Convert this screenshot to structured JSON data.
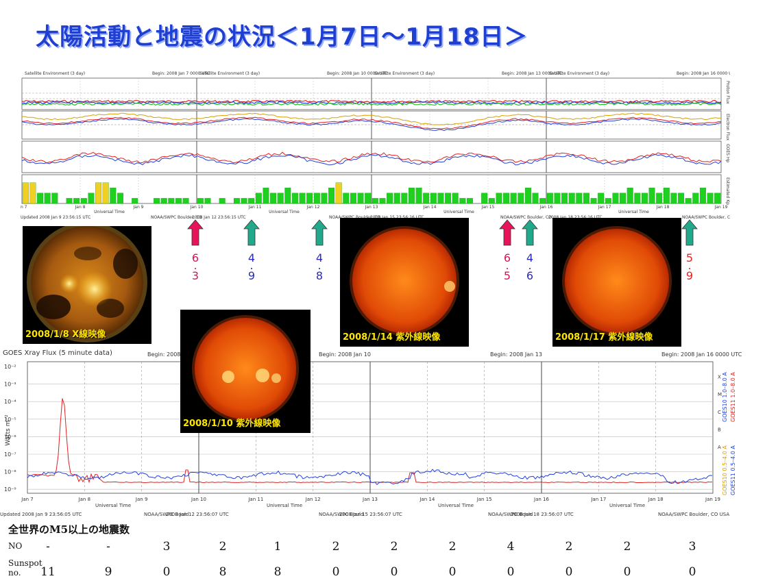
{
  "title": "太陽活動と地震の状況＜1月7日～1月18日＞",
  "top_panels": {
    "header_left": "Satellite Environment (3 day)",
    "begins": [
      "Begin: 2008 Jan 7 0000 UTC",
      "Begin: 2008 Jan 10 0000 UTC",
      "Begin: 2008 Jan 13 0000 UTC",
      "Begin: 2008 Jan 16 0000 UTC"
    ],
    "right_labels": [
      "Proton Flux",
      "Electron Flux",
      "GOES Hp",
      "Estimated Kp"
    ],
    "x_ticks": [
      "Jan 7",
      "Jan 8",
      "Jan 9",
      "Jan 10",
      "Jan 11",
      "Jan 12",
      "Jan 13",
      "Jan 14",
      "Jan 15",
      "Jan 16",
      "Jan 17",
      "Jan 18",
      "Jan 19"
    ],
    "universal_time": "Universal Time",
    "updated": [
      "Updated 2008 Jan 9 23:56:15 UTC",
      "NOAA/SWPC Boulder, CO",
      "2008 Jan 12 23:56:15 UTC",
      "NOAA/SWPC Boulder, CO",
      "2008 Jan 15 23:56:16 UTC",
      "NOAA/SWPC Boulder, CO",
      "2008 Jan 18 23:56:16 UTC",
      "NOAA/SWPC Boulder, CO USA"
    ]
  },
  "kp_values": [
    4,
    4,
    2,
    2,
    2,
    0,
    1,
    1,
    1,
    2,
    4,
    4,
    3,
    2,
    0,
    1,
    0,
    0,
    1,
    1,
    1,
    1,
    1,
    0,
    1,
    1,
    0,
    1,
    0,
    1,
    1,
    1,
    2,
    3,
    2,
    2,
    3,
    2,
    2,
    2,
    2,
    2,
    3,
    4,
    2,
    2,
    2,
    2,
    1,
    1,
    2,
    2,
    2,
    3,
    3,
    2,
    2,
    2,
    2,
    2,
    1,
    1,
    0,
    2,
    1,
    2,
    2,
    2,
    2,
    3,
    2,
    1,
    2,
    2,
    2,
    2,
    2,
    2,
    1,
    2,
    1,
    2,
    2,
    3,
    2,
    2,
    3,
    2,
    3,
    2,
    2,
    1,
    2,
    3,
    2,
    2
  ],
  "sun_images": [
    {
      "caption": "2008/1/8 X線映像",
      "kind": "xray"
    },
    {
      "caption": "2008/1/10 紫外線映像",
      "kind": "uv"
    },
    {
      "caption": "2008/1/14 紫外線映像",
      "kind": "uv"
    },
    {
      "caption": "2008/1/17 紫外線映像",
      "kind": "uv"
    }
  ],
  "markers": [
    {
      "top": "6",
      "bottom": "3",
      "color": "#e8145a",
      "arrow": "#e8145a",
      "num_color": "#d4145a"
    },
    {
      "top": "4",
      "bottom": "9",
      "color": "#2a9f8b",
      "arrow": "#22a98c",
      "num_color": "#2a2ab8"
    },
    {
      "top": "4",
      "bottom": "8",
      "color": "#2a9f8b",
      "arrow": "#22a98c",
      "num_color": "#2a2ab8"
    },
    {
      "top": "6",
      "bottom": "5",
      "color": "#e8145a",
      "arrow": "#e8145a",
      "num_color": "#d4145a"
    },
    {
      "top": "4",
      "bottom": "6",
      "color": "#2a9f8b",
      "arrow": "#22a98c",
      "num_color": "#2a2ab8"
    },
    {
      "top": "5",
      "bottom": "9",
      "color": "#2a9f8b",
      "arrow": "#22a98c",
      "num_color": "#e81e1e"
    }
  ],
  "xray": {
    "title": "GOES Xray Flux (5 minute data)",
    "begins": [
      "Begin: 2008",
      "Begin: 2008 Jan 10",
      "Begin: 2008 Jan 13",
      "Begin: 2008 Jan 16 0000 UTC"
    ],
    "y_label": "Watts m⁻²",
    "y_ticks": [
      "10⁻²",
      "10⁻³",
      "10⁻⁴",
      "10⁻⁵",
      "10⁻⁶",
      "10⁻⁷",
      "10⁻⁸",
      "10⁻⁹"
    ],
    "class_labels": [
      "X",
      "M",
      "C",
      "B",
      "A"
    ],
    "legend": [
      "GOES10 1.0–8.0 A",
      "GOES11 1.0–8.0 A",
      "GOES10 0.5–4.0 A",
      "GOES11 0.5–4.0 A"
    ],
    "x_ticks": [
      "Jan 7",
      "Jan 8",
      "Jan 9",
      "Jan 10",
      "Jan 11",
      "Jan 12",
      "Jan 13",
      "Jan 14",
      "Jan 15",
      "Jan 16",
      "Jan 17",
      "Jan 18",
      "Jan 19"
    ],
    "universal_time": "Universal Time",
    "updated": [
      "Updated 2008 Jan 9 23:56:05 UTC",
      "NOAA/SWPC Bould",
      "2008 Jan 12 23:56:07 UTC",
      "NOAA/SWPC Bould",
      "2008 Jan 15 23:56:07 UTC",
      "NOAA/SWPC Bould",
      "2008 Jan 18 23:56:07 UTC",
      "NOAA/SWPC Boulder, CO USA"
    ]
  },
  "quake_table": {
    "title": "全世界のM5以上の地震数",
    "row1_label": "NO",
    "row2_label": "Sunspot no.",
    "no": [
      "-",
      "-",
      "3",
      "2",
      "1",
      "2",
      "2",
      "2",
      "4",
      "2",
      "2",
      "3"
    ],
    "sunspot": [
      "11",
      "9",
      "0",
      "8",
      "8",
      "0",
      "0",
      "0",
      "0",
      "0",
      "0",
      "0"
    ]
  }
}
